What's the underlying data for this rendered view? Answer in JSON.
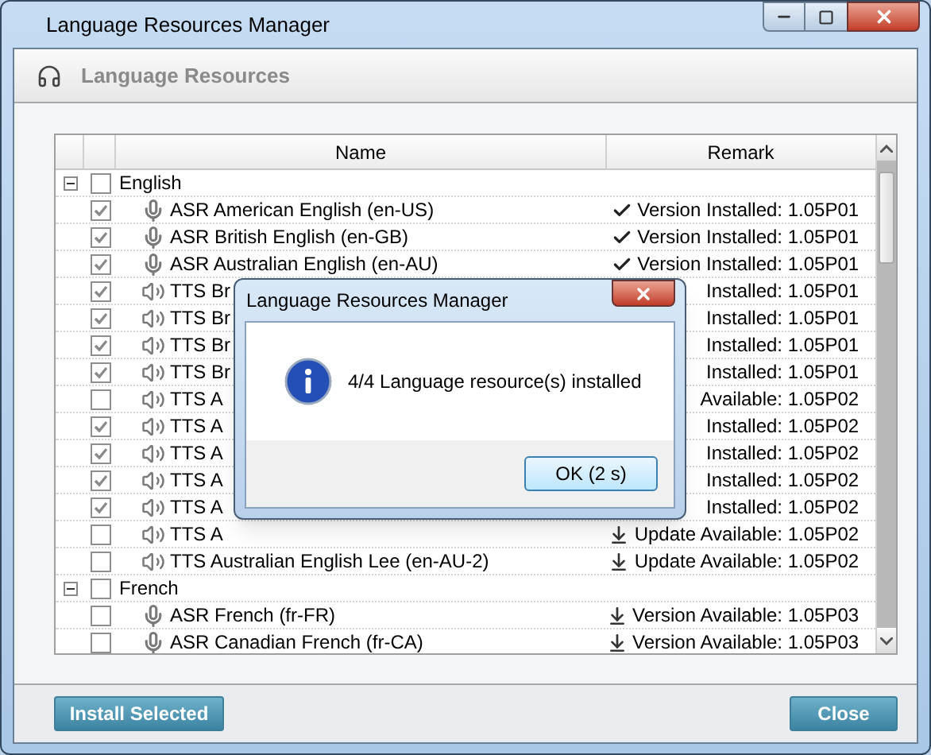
{
  "window": {
    "title": "Language Resources Manager"
  },
  "header": {
    "title": "Language Resources"
  },
  "table": {
    "columns": [
      "Name",
      "Remark"
    ],
    "groups": [
      {
        "label": "English",
        "expanded": true,
        "checked": false,
        "children": [
          {
            "kind": "microphone",
            "name": "ASR American English (en-US)",
            "checked": true,
            "remark": {
              "kind": "check",
              "text": "Version Installed: 1.05P01"
            }
          },
          {
            "kind": "microphone",
            "name": "ASR British English (en-GB)",
            "checked": true,
            "remark": {
              "kind": "check",
              "text": "Version Installed: 1.05P01"
            }
          },
          {
            "kind": "microphone",
            "name": "ASR Australian English (en-AU)",
            "checked": true,
            "remark": {
              "kind": "check",
              "text": "Version Installed: 1.05P01"
            }
          },
          {
            "kind": "speaker",
            "name": "TTS Br",
            "checked": true,
            "remark": {
              "text": "Installed: 1.05P01"
            }
          },
          {
            "kind": "speaker",
            "name": "TTS Br",
            "checked": true,
            "remark": {
              "text": "Installed: 1.05P01"
            }
          },
          {
            "kind": "speaker",
            "name": "TTS Br",
            "checked": true,
            "remark": {
              "text": "Installed: 1.05P01"
            }
          },
          {
            "kind": "speaker",
            "name": "TTS Br",
            "checked": true,
            "remark": {
              "text": "Installed: 1.05P01"
            }
          },
          {
            "kind": "speaker",
            "name": "TTS A",
            "checked": false,
            "remark": {
              "text": "Available: 1.05P02"
            }
          },
          {
            "kind": "speaker",
            "name": "TTS A",
            "checked": true,
            "remark": {
              "text": "Installed: 1.05P02"
            }
          },
          {
            "kind": "speaker",
            "name": "TTS A",
            "checked": true,
            "remark": {
              "text": "Installed: 1.05P02"
            }
          },
          {
            "kind": "speaker",
            "name": "TTS A",
            "checked": true,
            "remark": {
              "text": "Installed: 1.05P02"
            }
          },
          {
            "kind": "speaker",
            "name": "TTS A",
            "checked": true,
            "remark": {
              "text": "Installed: 1.05P02"
            }
          },
          {
            "kind": "speaker",
            "name": "TTS A",
            "checked": false,
            "remark": {
              "kind": "download",
              "text": "Update Available: 1.05P02"
            }
          },
          {
            "kind": "speaker",
            "name": "TTS Australian English Lee (en-AU-2)",
            "checked": false,
            "remark": {
              "kind": "download",
              "text": "Update Available: 1.05P02"
            }
          }
        ]
      },
      {
        "label": "French",
        "expanded": true,
        "checked": false,
        "children": [
          {
            "kind": "microphone",
            "name": "ASR French (fr-FR)",
            "checked": false,
            "remark": {
              "kind": "download",
              "text": "Version Available: 1.05P03"
            }
          },
          {
            "kind": "microphone",
            "name": "ASR Canadian French (fr-CA)",
            "checked": false,
            "remark": {
              "kind": "download",
              "text": "Version Available: 1.05P03"
            }
          }
        ]
      }
    ]
  },
  "buttons": [
    "Install Selected",
    "Close"
  ],
  "dialog": {
    "title": "Language Resources Manager",
    "message": "4/4 Language resource(s) installed",
    "button": "OK (2 s)"
  }
}
